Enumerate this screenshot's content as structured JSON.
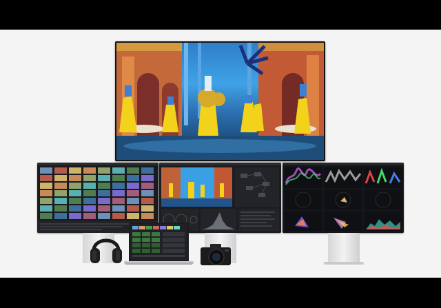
{
  "scene": {
    "background": "#f4f4f5",
    "accent": "#3fa2e6"
  },
  "devices": {
    "tv": "display-with-dance-scene",
    "monitor_left": "media-browser",
    "monitor_center": "color-page",
    "monitor_right": "video-scopes",
    "laptop": "editing-keyboard",
    "headphones": "headphones-icon",
    "camera": "camera-icon"
  }
}
